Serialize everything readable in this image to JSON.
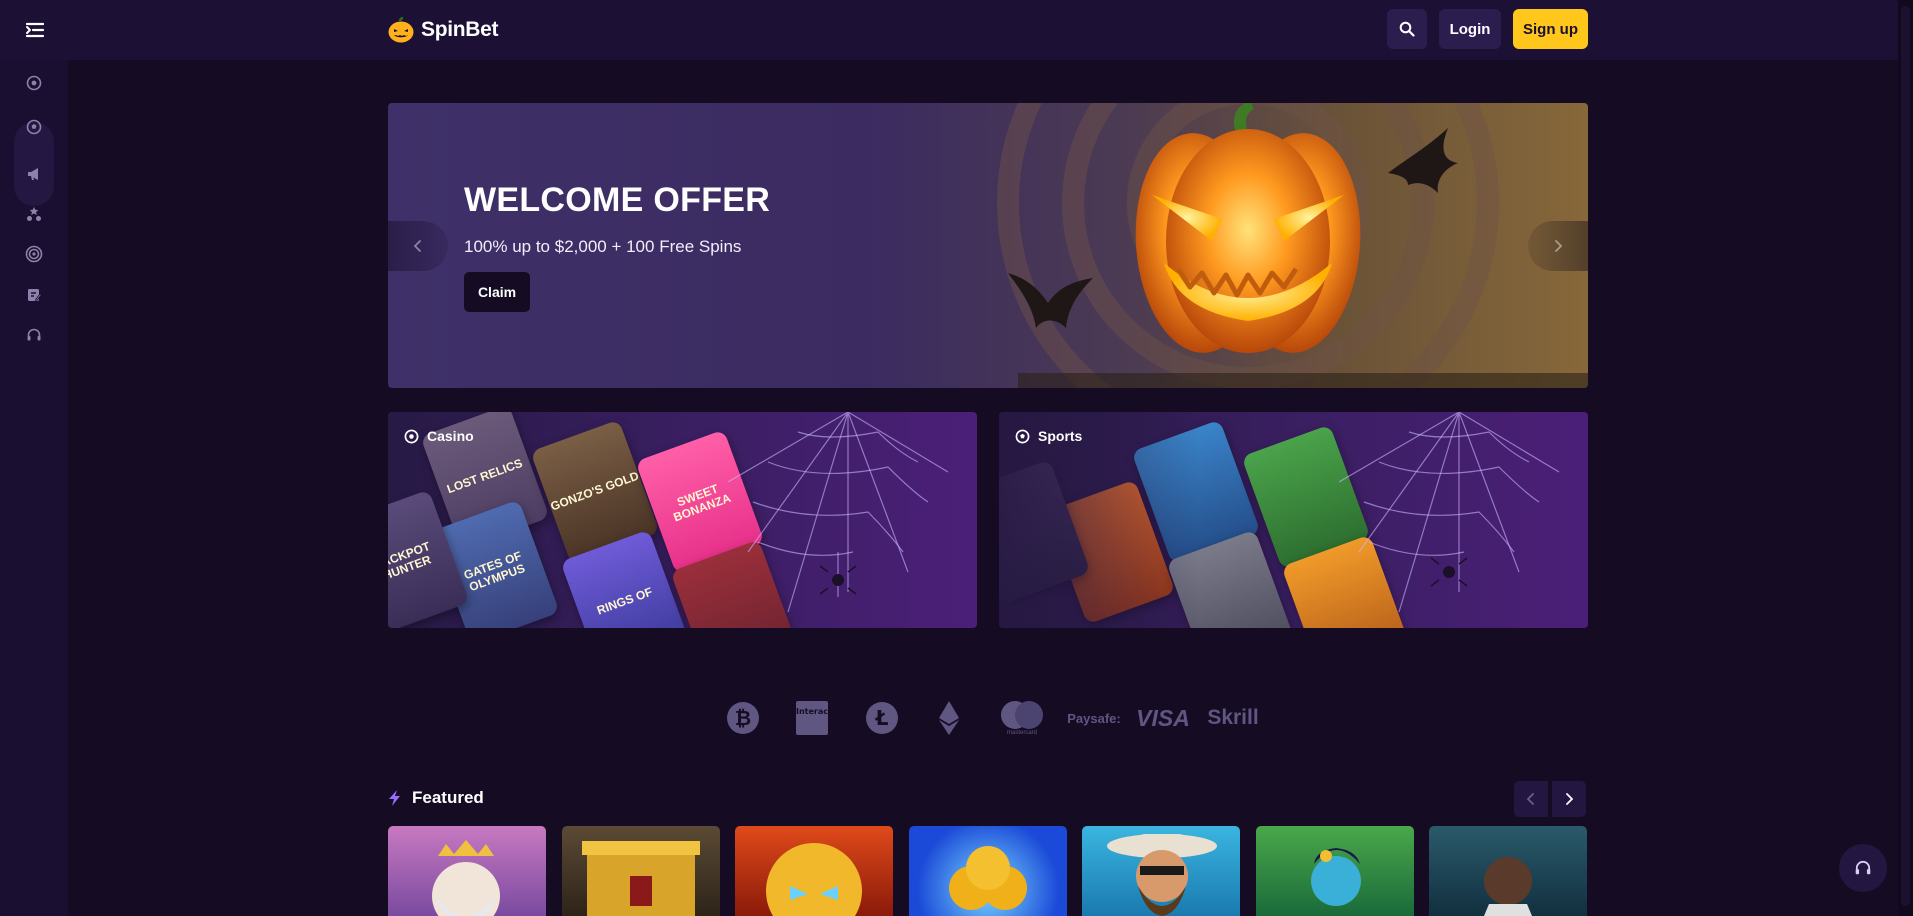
{
  "header": {
    "brand": "SpinBet",
    "login_label": "Login",
    "signup_label": "Sign up",
    "icons": [
      "menu-toggle-icon",
      "search-icon"
    ]
  },
  "sidebar": {
    "items": [
      {
        "name": "casino",
        "icon": "chip-icon"
      },
      {
        "name": "sports",
        "icon": "soccer-ball-icon"
      },
      {
        "name": "promotions",
        "icon": "megaphone-icon"
      },
      {
        "name": "loyalty",
        "icon": "stars-icon"
      },
      {
        "name": "tournaments",
        "icon": "target-icon"
      },
      {
        "name": "blog",
        "icon": "edit-icon"
      },
      {
        "name": "support",
        "icon": "headset-icon"
      }
    ]
  },
  "hero": {
    "title": "WELCOME OFFER",
    "subtitle": "100% up to $2,000 + 100 Free Spins",
    "cta_label": "Claim"
  },
  "categories": [
    {
      "label": "Casino",
      "icon": "chip-icon",
      "tiles": [
        "LOST RELICS",
        "GONZO'S GOLD",
        "SWEET BONANZA",
        "GATES OF OLYMPUS",
        "JACKPOT HUNTER",
        "RINGS OF"
      ]
    },
    {
      "label": "Sports",
      "icon": "soccer-ball-icon"
    }
  ],
  "payments": [
    {
      "name": "bitcoin",
      "icon": "bitcoin-icon"
    },
    {
      "name": "interac",
      "label": "Interac",
      "icon": "interac-icon"
    },
    {
      "name": "litecoin",
      "icon": "litecoin-icon"
    },
    {
      "name": "ethereum",
      "icon": "ethereum-icon"
    },
    {
      "name": "mastercard",
      "icon": "mastercard-icon",
      "label": "mastercard"
    },
    {
      "name": "paysafe",
      "label": "Paysafe:"
    },
    {
      "name": "visa",
      "label": "VISA"
    },
    {
      "name": "skrill",
      "label": "Skrill"
    }
  ],
  "featured": {
    "title": "Featured",
    "icon": "lightning-icon"
  },
  "colors": {
    "background": "#150c24",
    "topbar": "#1c1035",
    "accent_yellow": "#ffc61c",
    "button_dark": "#2c1d4f",
    "lightning": "#9b6bff"
  }
}
